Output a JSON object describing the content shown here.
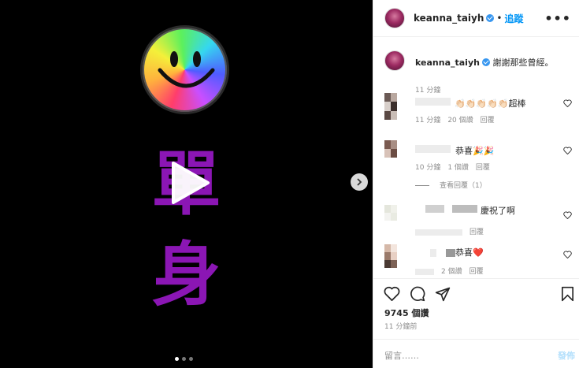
{
  "post": {
    "username": "keanna_taiyh",
    "follow_label": "追蹤",
    "dot": "•",
    "more": "•••"
  },
  "media": {
    "line1": "單",
    "line2": "身",
    "carousel_total": 3,
    "carousel_index": 0
  },
  "caption": {
    "username": "keanna_taiyh",
    "text": "謝謝那些曾經。",
    "time": "11 分鐘"
  },
  "comments": [
    {
      "text": "👏🏻👏🏻👏🏻👏🏻👏🏻超棒",
      "time": "11 分鐘",
      "likes": "20 個讚",
      "reply": "回覆"
    },
    {
      "text": "恭喜🎉🎉",
      "time": "10 分鐘",
      "likes": "1 個讚",
      "reply": "回覆"
    },
    {
      "text": "慶祝了啊",
      "time": "",
      "likes": "",
      "reply": "回覆"
    },
    {
      "text": "恭喜❤️",
      "time": "",
      "likes": "2 個讚",
      "reply": "回覆"
    }
  ],
  "view_replies": "查看回覆（1）",
  "likes_total": "9745 個讚",
  "posted_ago": "11 分鐘前",
  "add_comment_placeholder": "留言……",
  "post_button": "發佈",
  "colors": {
    "accent": "#0095f6",
    "text_purple": "#8b16b4"
  }
}
